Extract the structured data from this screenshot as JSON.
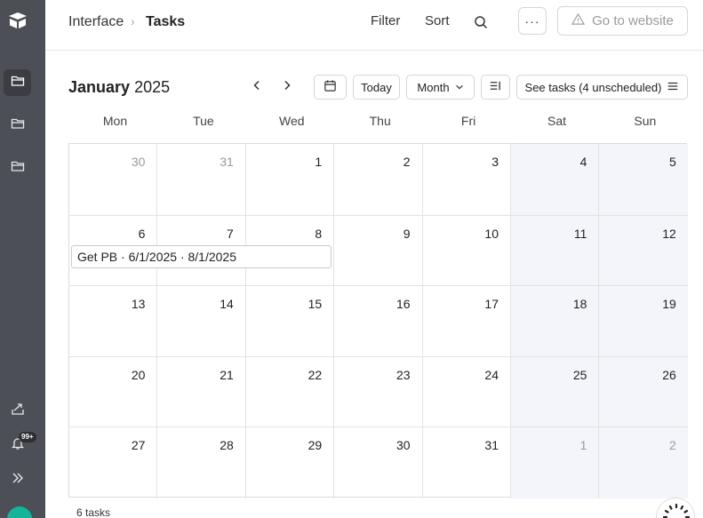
{
  "sidebar": {
    "notification_badge": "99+",
    "icons": [
      "logo-icon",
      "folder-icon",
      "folder-icon",
      "folder-icon",
      "share-icon",
      "bell-icon",
      "expand-icon"
    ]
  },
  "header": {
    "breadcrumb_root": "Interface",
    "breadcrumb_separator": "›",
    "breadcrumb_current": "Tasks",
    "filter_label": "Filter",
    "sort_label": "Sort",
    "more_label": "···",
    "go_to_website_label": "Go to website"
  },
  "toolbar": {
    "month_name": "January",
    "year": "2025",
    "today_label": "Today",
    "view_label": "Month",
    "see_tasks_label": "See tasks (4 unscheduled)"
  },
  "calendar": {
    "weekdays": [
      "Mon",
      "Tue",
      "Wed",
      "Thu",
      "Fri",
      "Sat",
      "Sun"
    ],
    "weeks": [
      [
        {
          "d": "30",
          "muted": true
        },
        {
          "d": "31",
          "muted": true
        },
        {
          "d": "1"
        },
        {
          "d": "2"
        },
        {
          "d": "3"
        },
        {
          "d": "4"
        },
        {
          "d": "5"
        }
      ],
      [
        {
          "d": "6"
        },
        {
          "d": "7"
        },
        {
          "d": "8"
        },
        {
          "d": "9"
        },
        {
          "d": "10"
        },
        {
          "d": "11"
        },
        {
          "d": "12"
        }
      ],
      [
        {
          "d": "13"
        },
        {
          "d": "14"
        },
        {
          "d": "15"
        },
        {
          "d": "16"
        },
        {
          "d": "17"
        },
        {
          "d": "18"
        },
        {
          "d": "19"
        }
      ],
      [
        {
          "d": "20"
        },
        {
          "d": "21"
        },
        {
          "d": "22"
        },
        {
          "d": "23"
        },
        {
          "d": "24"
        },
        {
          "d": "25"
        },
        {
          "d": "26"
        }
      ],
      [
        {
          "d": "27"
        },
        {
          "d": "28"
        },
        {
          "d": "29"
        },
        {
          "d": "30"
        },
        {
          "d": "31"
        },
        {
          "d": "1",
          "muted": true
        },
        {
          "d": "2",
          "muted": true
        }
      ]
    ],
    "event": "Get PB · 6/1/2025 · 8/1/2025"
  },
  "footer": {
    "task_count": "6 tasks"
  },
  "colors": {
    "sidebar_bg": "#4c4f56",
    "weekend_bg": "#f3f5fa",
    "avatar": "#13b59a"
  }
}
